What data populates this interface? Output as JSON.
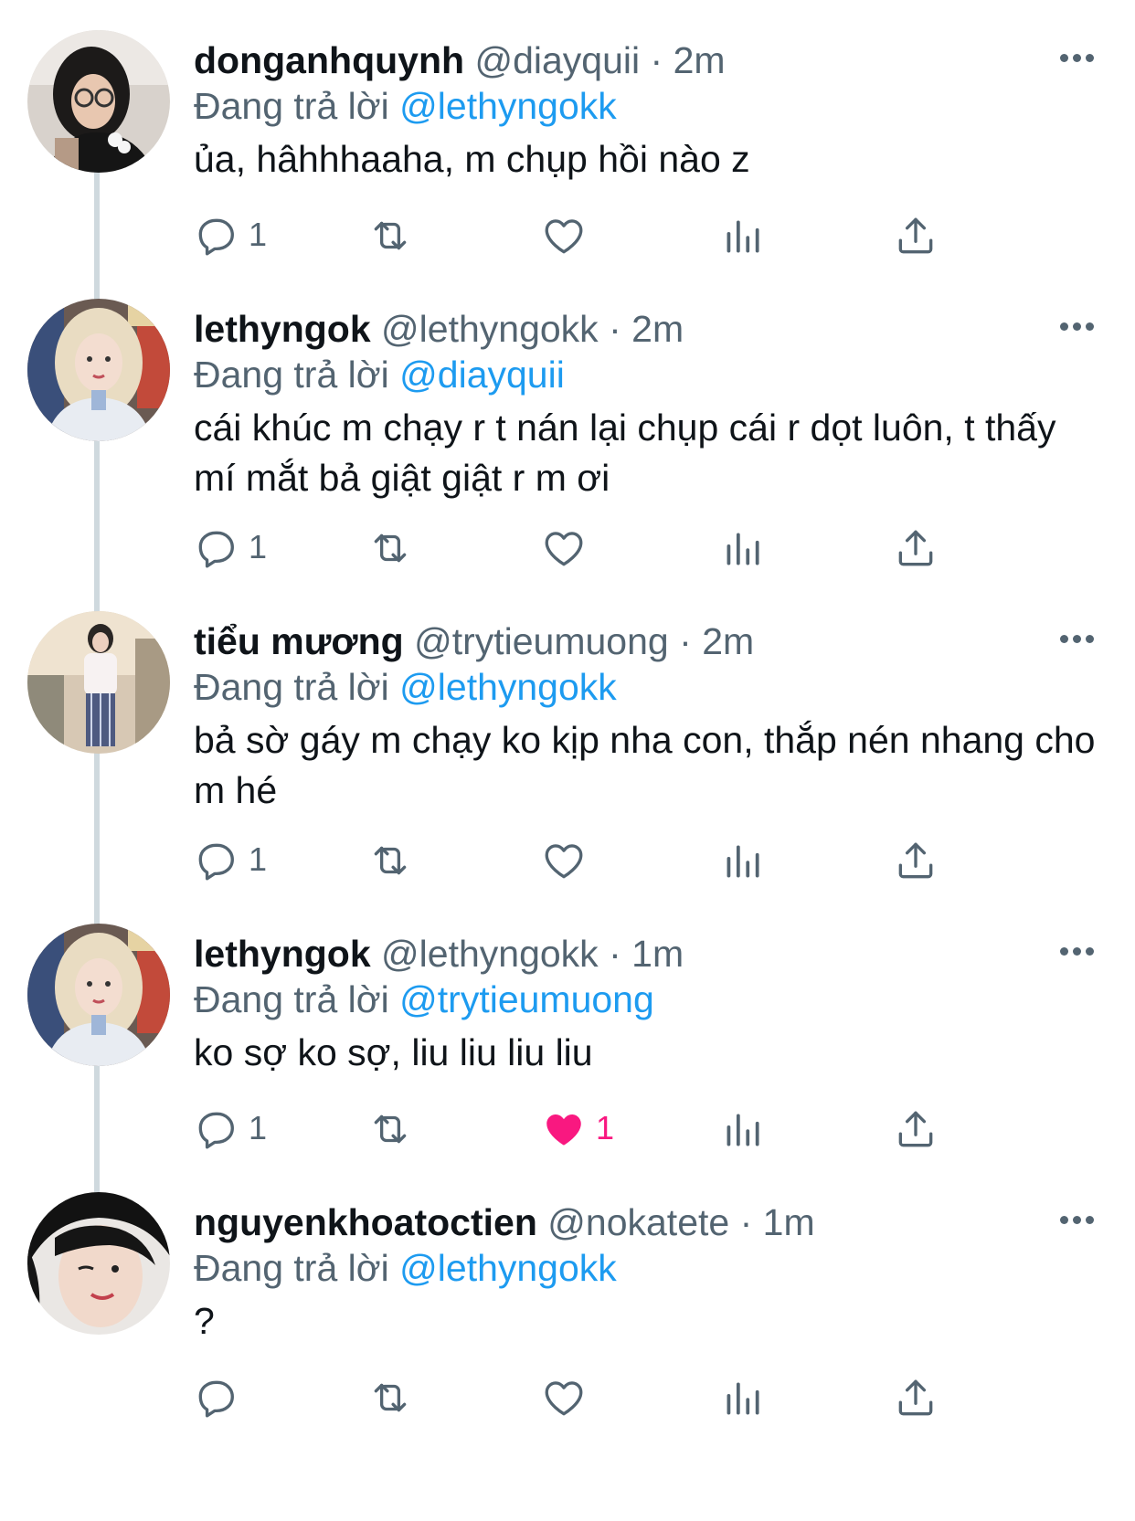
{
  "colors": {
    "text": "#0f1419",
    "secondary": "#536471",
    "mention": "#1d9bf0",
    "like_active": "#f91880",
    "thread_line": "#cfd9de"
  },
  "labels": {
    "replying_to": "Đang trả lời"
  },
  "tweets": [
    {
      "display_name": "donganhquynh",
      "handle": "@diayquii",
      "time": "2m",
      "reply_to": "@lethyngokk",
      "text": "ủa, hâhhhaaha, m chụp hồi nào z",
      "reply_count": "1",
      "like_count": "",
      "liked": false,
      "avatar_icon": "avatar-photo-donganhquynh"
    },
    {
      "display_name": "lethyngok",
      "handle": "@lethyngokk",
      "time": "2m",
      "reply_to": "@diayquii",
      "text": "cái khúc m chạy r t nán lại chụp cái r dọt luôn, t thấy mí mắt bả giật giật r m ơi",
      "reply_count": "1",
      "like_count": "",
      "liked": false,
      "avatar_icon": "avatar-photo-lethyngok"
    },
    {
      "display_name": "tiểu mương",
      "handle": "@trytieumuong",
      "time": "2m",
      "reply_to": "@lethyngokk",
      "text": "bả sờ gáy m chạy ko kịp nha con, thắp nén nhang cho m hé",
      "reply_count": "1",
      "like_count": "",
      "liked": false,
      "avatar_icon": "avatar-photo-tieumuong"
    },
    {
      "display_name": "lethyngok",
      "handle": "@lethyngokk",
      "time": "1m",
      "reply_to": "@trytieumuong",
      "text": "ko sợ ko sợ, liu liu liu liu",
      "reply_count": "1",
      "like_count": "1",
      "liked": true,
      "avatar_icon": "avatar-photo-lethyngok"
    },
    {
      "display_name": "nguyenkhoatoctien",
      "handle": "@nokatete",
      "time": "1m",
      "reply_to": "@lethyngokk",
      "text": "?",
      "reply_count": "",
      "like_count": "",
      "liked": false,
      "avatar_icon": "avatar-photo-nguyenkhoatoctien"
    }
  ]
}
